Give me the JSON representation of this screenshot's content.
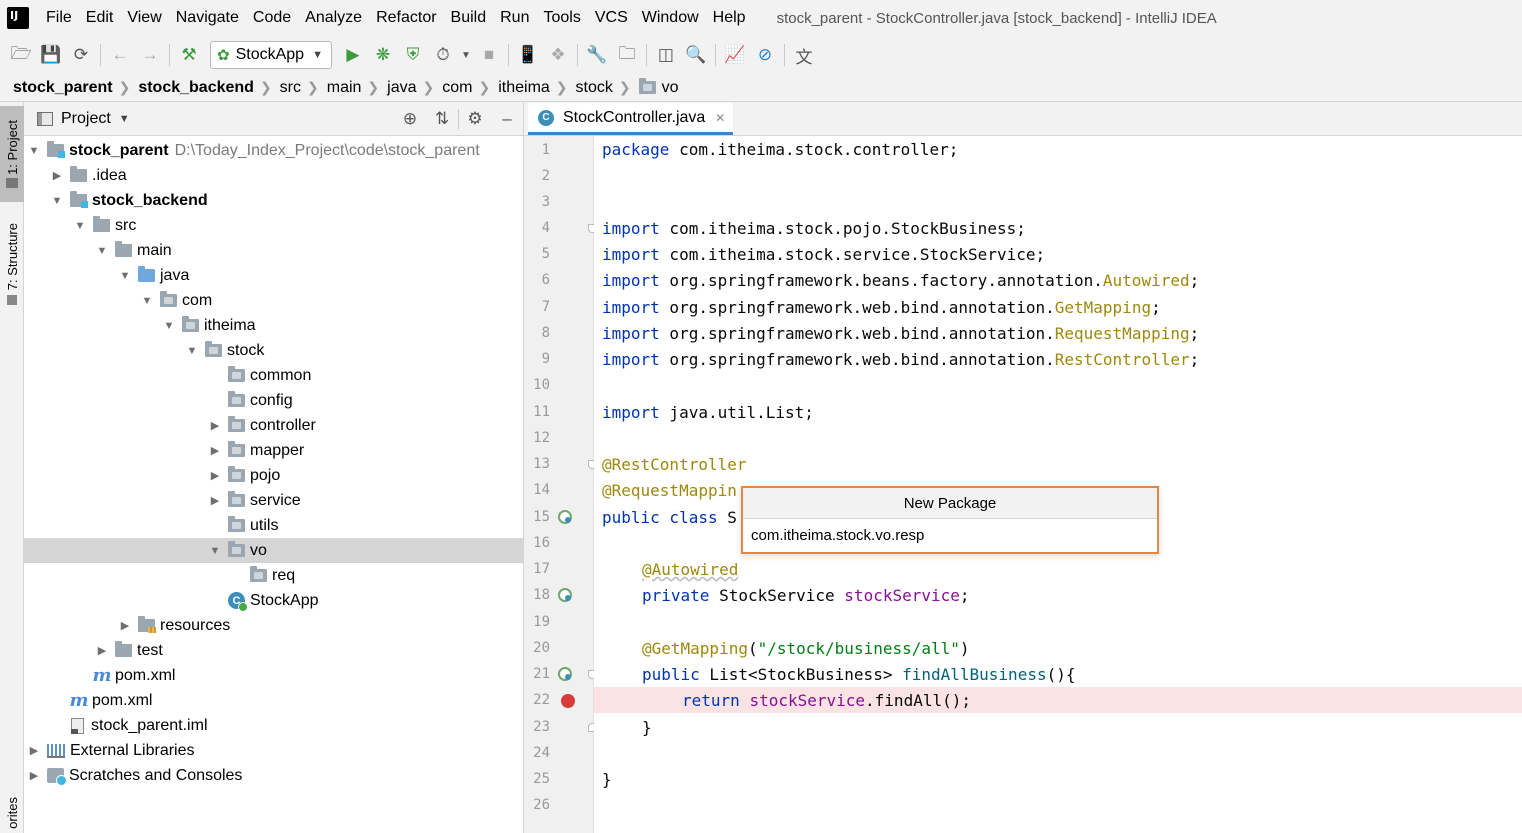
{
  "menubar": {
    "items": [
      "File",
      "Edit",
      "View",
      "Navigate",
      "Code",
      "Analyze",
      "Refactor",
      "Build",
      "Run",
      "Tools",
      "VCS",
      "Window",
      "Help"
    ],
    "window_title": "stock_parent - StockController.java [stock_backend] - IntelliJ IDEA"
  },
  "toolbar": {
    "run_config": "StockApp"
  },
  "breadcrumb": {
    "items": [
      "stock_parent",
      "stock_backend",
      "src",
      "main",
      "java",
      "com",
      "itheima",
      "stock",
      "vo"
    ]
  },
  "left_strip": {
    "project_tab": "1: Project",
    "structure_tab": "7: Structure",
    "favorites_tab": "orites"
  },
  "project_panel": {
    "title": "Project",
    "root_label": "stock_parent",
    "root_path": "D:\\Today_Index_Project\\code\\stock_parent",
    "tree": [
      {
        "label": "stock_parent",
        "depth": 0
      },
      {
        "label": ".idea",
        "depth": 1
      },
      {
        "label": "stock_backend",
        "depth": 1
      },
      {
        "label": "src",
        "depth": 2
      },
      {
        "label": "main",
        "depth": 3
      },
      {
        "label": "java",
        "depth": 4
      },
      {
        "label": "com",
        "depth": 5
      },
      {
        "label": "itheima",
        "depth": 6
      },
      {
        "label": "stock",
        "depth": 7
      },
      {
        "label": "common",
        "depth": 8
      },
      {
        "label": "config",
        "depth": 8
      },
      {
        "label": "controller",
        "depth": 8
      },
      {
        "label": "mapper",
        "depth": 8
      },
      {
        "label": "pojo",
        "depth": 8
      },
      {
        "label": "service",
        "depth": 8
      },
      {
        "label": "utils",
        "depth": 8
      },
      {
        "label": "vo",
        "depth": 8
      },
      {
        "label": "req",
        "depth": 9
      },
      {
        "label": "StockApp",
        "depth": 8
      },
      {
        "label": "resources",
        "depth": 4
      },
      {
        "label": "test",
        "depth": 3
      },
      {
        "label": "pom.xml",
        "depth": 2
      },
      {
        "label": "pom.xml",
        "depth": 1
      },
      {
        "label": "stock_parent.iml",
        "depth": 1
      },
      {
        "label": "External Libraries",
        "depth": 0
      },
      {
        "label": "Scratches and Consoles",
        "depth": 0
      }
    ]
  },
  "editor": {
    "tab_label": "StockController.java",
    "line_numbers": [
      "1",
      "2",
      "3",
      "4",
      "5",
      "6",
      "7",
      "8",
      "9",
      "10",
      "11",
      "12",
      "13",
      "14",
      "15",
      "16",
      "17",
      "18",
      "19",
      "20",
      "21",
      "22",
      "23",
      "24",
      "25",
      "26"
    ],
    "code": {
      "l1_kw": "package",
      "l1_rest": " com.itheima.stock.controller;",
      "import_kw": "import",
      "l4": " com.itheima.stock.pojo.StockBusiness;",
      "l5": " com.itheima.stock.service.StockService;",
      "l6_a": " org.springframework.beans.factory.annotation.",
      "l6_b": "Autowired",
      "l7_a": " org.springframework.web.bind.annotation.",
      "l7_b": "GetMapping",
      "l8_a": " org.springframework.web.bind.annotation.",
      "l8_b": "RequestMapping",
      "l9_a": " org.springframework.web.bind.annotation.",
      "l9_b": "RestController",
      "semicolon": ";",
      "l11": " java.util.List;",
      "l13": "@RestController",
      "l14": "@RequestMappin",
      "l15_kw": "public class",
      "l15_rest": " S",
      "l17": "@Autowired",
      "l18_kw": "private",
      "l18_type": " StockService ",
      "l18_field": "stockService",
      "l20_ann": "@GetMapping",
      "l20_open": "(",
      "l20_str": "\"/stock/business/all\"",
      "l20_close": ")",
      "l21_kw": "public",
      "l21_type": " List<StockBusiness> ",
      "l21_fn": "findAllBusiness",
      "l21_rest": "(){",
      "l22_kw": "return",
      "l22_sp": " ",
      "l22_field": "stockService",
      "l22_rest": ".findAll();",
      "close_brace": "}"
    }
  },
  "popup": {
    "title": "New Package",
    "value": "com.itheima.stock.vo.resp"
  }
}
